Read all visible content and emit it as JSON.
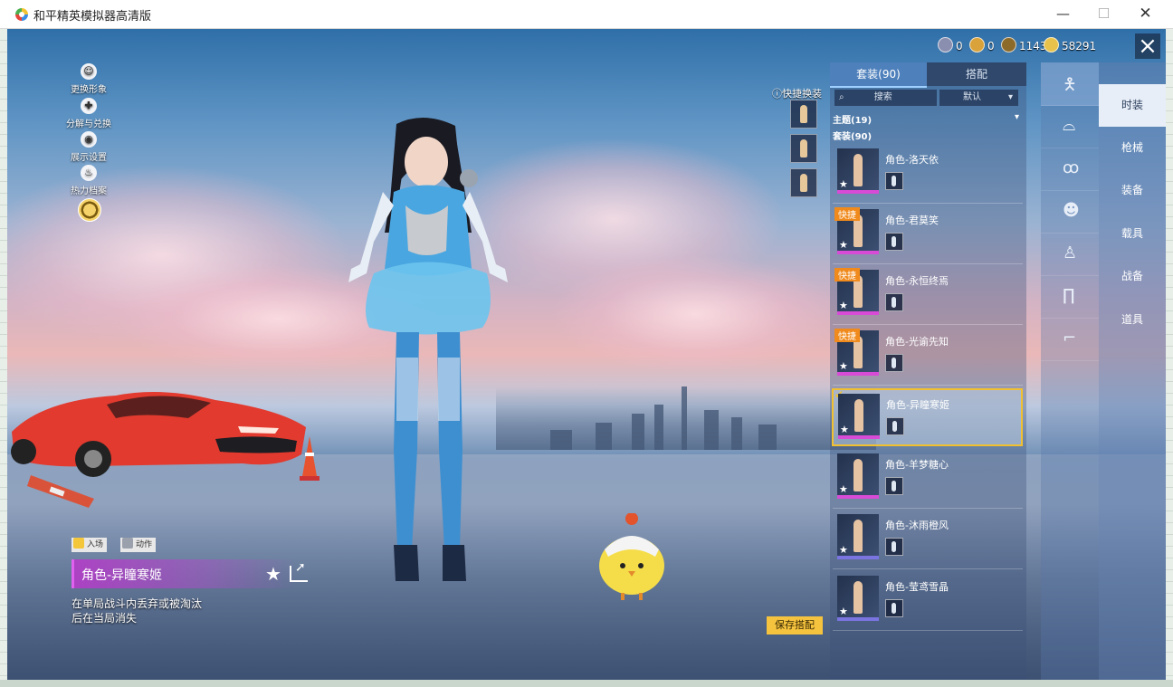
{
  "window": {
    "title": "和平精英模拟器高清版",
    "minimize": "—",
    "maximize": "☐",
    "close": "✕"
  },
  "side_menu": [
    {
      "label": "更换形象",
      "icon": "person-icon"
    },
    {
      "label": "分解与兑换",
      "icon": "dismantle-icon"
    },
    {
      "label": "展示设置",
      "icon": "eye-icon"
    },
    {
      "label": "热力档案",
      "icon": "flame-icon"
    }
  ],
  "currencies": [
    {
      "value": "0",
      "color": "#8a8fb0"
    },
    {
      "value": "0",
      "color": "#d9a23a"
    },
    {
      "value": "1143",
      "color": "#8c6a2a"
    },
    {
      "value": "58291",
      "color": "#e8c24a"
    }
  ],
  "quick_change": {
    "label": "快捷换装"
  },
  "tabs": {
    "suits": "套装(90)",
    "match": "搭配"
  },
  "search": {
    "placeholder": "搜索",
    "sort": "默认"
  },
  "sections": {
    "theme": "主题(19)",
    "suits": "套装(90)"
  },
  "outfits": [
    {
      "name": "角色-洛天依",
      "quick": "",
      "selected": false
    },
    {
      "name": "角色-君莫笑",
      "quick": "快捷",
      "selected": false
    },
    {
      "name": "角色-永恒终焉",
      "quick": "快捷",
      "selected": false
    },
    {
      "name": "角色-光谕先知",
      "quick": "快捷",
      "selected": false
    },
    {
      "name": "角色-异瞳寒姬",
      "quick": "",
      "selected": true
    },
    {
      "name": "角色-羊梦糖心",
      "quick": "",
      "selected": false
    },
    {
      "name": "角色-沐雨橙风",
      "quick": "",
      "selected": false
    },
    {
      "name": "角色-莹鸢雪晶",
      "quick": "",
      "selected": false
    }
  ],
  "categories": [
    {
      "label": "时装",
      "active": true
    },
    {
      "label": "枪械",
      "active": false
    },
    {
      "label": "装备",
      "active": false
    },
    {
      "label": "载具",
      "active": false
    },
    {
      "label": "战备",
      "active": false
    },
    {
      "label": "道具",
      "active": false
    }
  ],
  "save_button": "保存搭配",
  "actions": {
    "entrance": "入场",
    "motion": "动作"
  },
  "character": {
    "name": "角色-异瞳寒姬",
    "description": "在单局战斗内丢弃或被淘汰后在当局消失"
  },
  "colors": {
    "accent": "#f5c33d",
    "rarity": "#d84bd6",
    "selected_border": "#f0c030",
    "quick_tag": "#f08a1c"
  }
}
